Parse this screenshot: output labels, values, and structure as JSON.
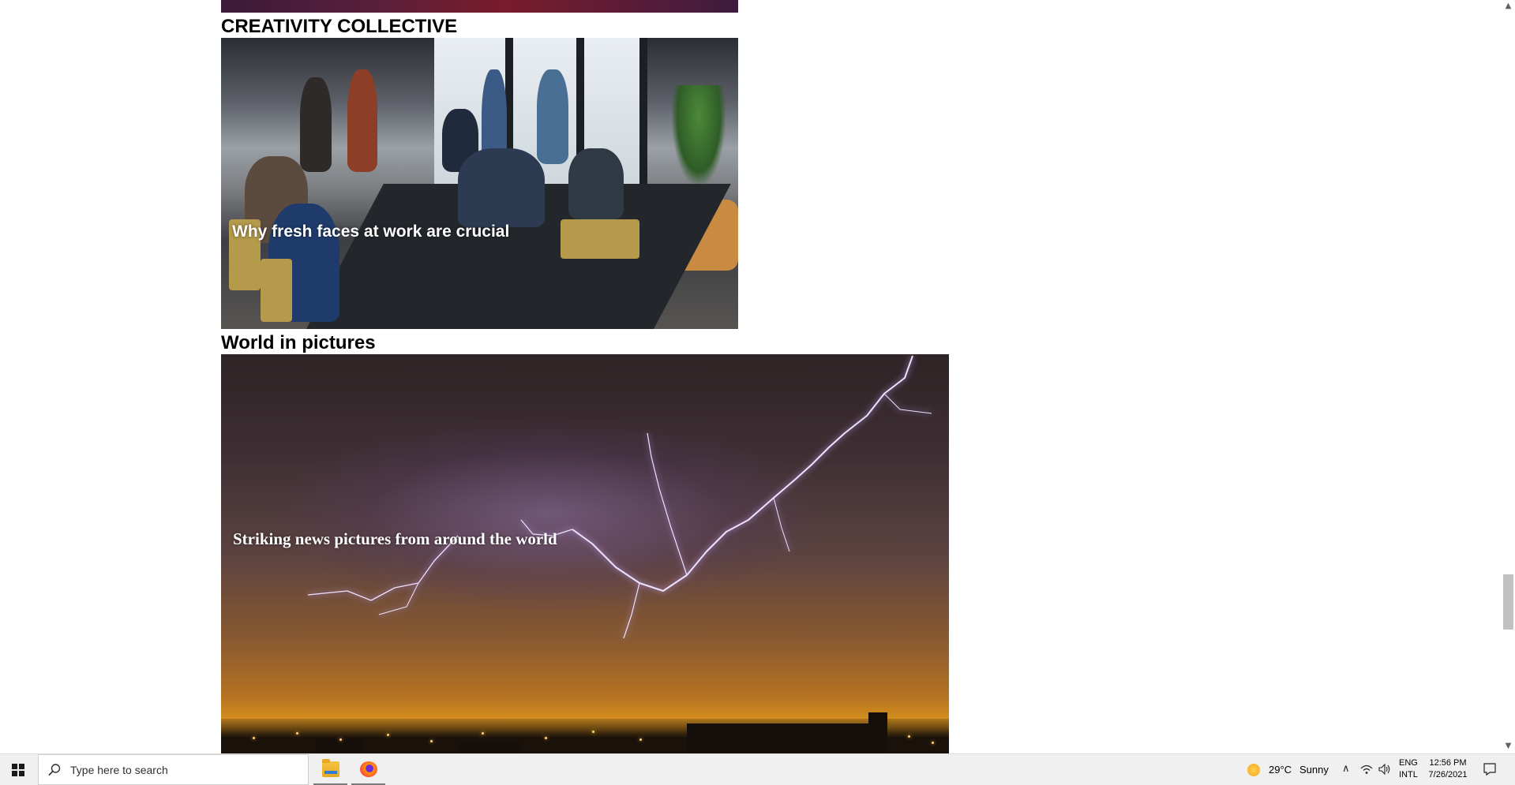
{
  "sections": {
    "creativity": {
      "heading": "CREATIVITY COLLECTIVE",
      "caption": "Why fresh faces at work are crucial"
    },
    "world": {
      "heading": "World in pictures",
      "caption": "Striking news pictures from around the world"
    }
  },
  "taskbar": {
    "search_placeholder": "Type here to search",
    "apps": [
      {
        "name": "File Explorer",
        "icon": "folder-icon"
      },
      {
        "name": "Firefox",
        "icon": "firefox-icon"
      }
    ],
    "weather": {
      "icon": "sun-icon",
      "temperature": "29°C",
      "condition": "Sunny"
    },
    "language": {
      "line1": "ENG",
      "line2": "INTL"
    },
    "clock": {
      "time": "12:56 PM",
      "date": "7/26/2021"
    }
  },
  "colors": {
    "taskbar_bg": "#f0f0f0",
    "scroll_thumb": "#c1c1c1",
    "caption_text": "#ffffff"
  }
}
